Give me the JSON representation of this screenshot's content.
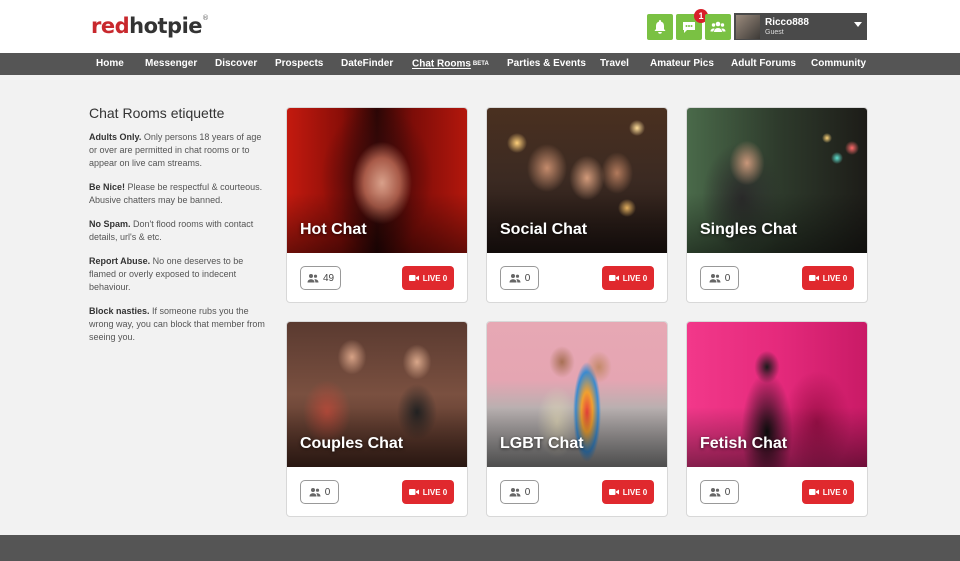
{
  "logo": {
    "part1": "red",
    "part2": "hotpie",
    "mark": "®"
  },
  "header": {
    "notifications_icon": "bell-icon",
    "messages_icon": "chat-icon",
    "messages_badge": "1",
    "friends_icon": "group-icon",
    "user": {
      "name": "Ricco888",
      "role": "Guest"
    }
  },
  "nav": {
    "items": [
      "Home",
      "Messenger",
      "Discover",
      "Prospects",
      "DateFinder",
      "Chat Rooms",
      "Parties & Events",
      "Travel",
      "Amateur Pics",
      "Adult Forums",
      "Community"
    ],
    "active": "Chat Rooms",
    "beta_label": "BETA"
  },
  "etiquette": {
    "title": "Chat Rooms etiquette",
    "rules": [
      {
        "head": "Adults Only.",
        "text": " Only persons 18 years of age or over are permitted in chat rooms or to appear on live cam streams."
      },
      {
        "head": "Be Nice!",
        "text": " Please be respectful & courteous. Abusive chatters may be banned."
      },
      {
        "head": "No Spam.",
        "text": " Don't flood rooms with contact details, url's & etc."
      },
      {
        "head": "Report Abuse.",
        "text": " No one deserves to be flamed or overly exposed to indecent behaviour."
      },
      {
        "head": "Block nasties.",
        "text": " If someone rubs you the wrong way, you can block that member from seeing you."
      }
    ]
  },
  "rooms": [
    {
      "title": "Hot Chat",
      "count": "49",
      "live": "LIVE 0"
    },
    {
      "title": "Social Chat",
      "count": "0",
      "live": "LIVE 0"
    },
    {
      "title": "Singles Chat",
      "count": "0",
      "live": "LIVE 0"
    },
    {
      "title": "Couples Chat",
      "count": "0",
      "live": "LIVE 0"
    },
    {
      "title": "LGBT Chat",
      "count": "0",
      "live": "LIVE 0"
    },
    {
      "title": "Fetish Chat",
      "count": "0",
      "live": "LIVE 0"
    }
  ],
  "colors": {
    "brand_red": "#c8282d",
    "header_green": "#7ac143",
    "live_red": "#e0292e",
    "nav_gray": "#555555"
  }
}
